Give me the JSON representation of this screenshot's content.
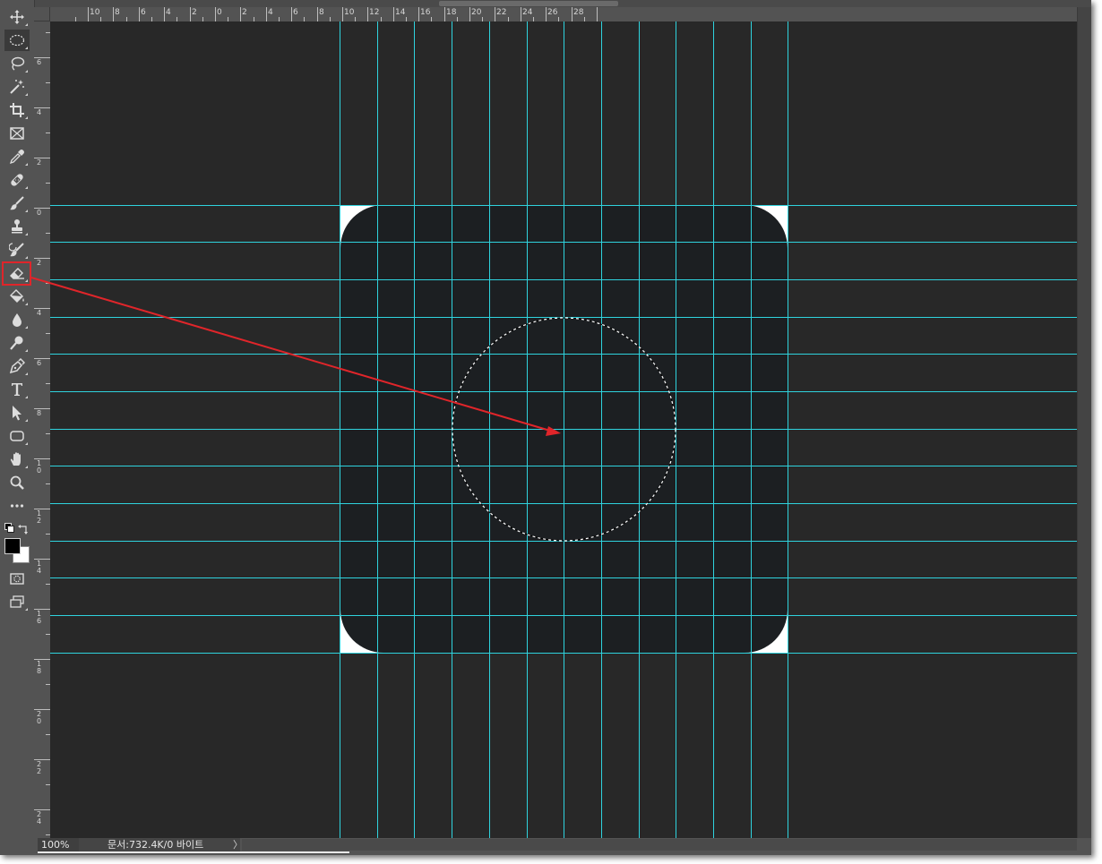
{
  "toolbar": {
    "tools": [
      {
        "name": "move-tool",
        "icon": "move-icon"
      },
      {
        "name": "elliptical-marquee-tool",
        "icon": "elliptical-marquee-icon"
      },
      {
        "name": "lasso-tool",
        "icon": "lasso-icon"
      },
      {
        "name": "magic-wand-tool",
        "icon": "magic-wand-icon"
      },
      {
        "name": "crop-tool",
        "icon": "crop-icon"
      },
      {
        "name": "frame-tool",
        "icon": "frame-icon"
      },
      {
        "name": "eyedropper-tool",
        "icon": "eyedropper-icon"
      },
      {
        "name": "healing-brush-tool",
        "icon": "bandage-icon"
      },
      {
        "name": "brush-tool",
        "icon": "brush-icon"
      },
      {
        "name": "clone-stamp-tool",
        "icon": "stamp-icon"
      },
      {
        "name": "history-brush-tool",
        "icon": "history-brush-icon"
      },
      {
        "name": "eraser-tool",
        "icon": "eraser-icon"
      },
      {
        "name": "paint-bucket-tool",
        "icon": "paint-bucket-icon"
      },
      {
        "name": "blur-tool",
        "icon": "droplet-icon"
      },
      {
        "name": "dodge-tool",
        "icon": "dodge-icon"
      },
      {
        "name": "pen-tool",
        "icon": "pen-icon"
      },
      {
        "name": "type-tool",
        "icon": "type-icon"
      },
      {
        "name": "path-selection-tool",
        "icon": "arrow-cursor-icon"
      },
      {
        "name": "rectangle-tool",
        "icon": "rounded-rectangle-icon"
      },
      {
        "name": "hand-tool",
        "icon": "hand-icon"
      },
      {
        "name": "zoom-tool",
        "icon": "magnifier-icon"
      },
      {
        "name": "edit-toolbar",
        "icon": "more-icon"
      }
    ],
    "active_tool": "elliptical-marquee-tool",
    "highlighted_tool": "eraser-tool",
    "foreground_color": "#000000",
    "background_color": "#ffffff"
  },
  "rulers": {
    "horizontal": [
      "10",
      "8",
      "6",
      "4",
      "2",
      "0",
      "2",
      "4",
      "6",
      "8",
      "10",
      "12",
      "14",
      "16",
      "18",
      "20",
      "22",
      "24",
      "26",
      "28"
    ],
    "vertical": [
      "6",
      "4",
      "2",
      "0",
      "2",
      "4",
      "6",
      "8",
      "10",
      "12",
      "14",
      "16",
      "18",
      "20",
      "22",
      "24"
    ]
  },
  "canvas": {
    "pasteboard_color": "#282828",
    "document_color": "#1c1f22",
    "corner_color": "#ffffff",
    "guide_color": "#2fd3de",
    "arrow_color": "#e0252a"
  },
  "status": {
    "zoom": "100%",
    "doc_info": "문서:732.4K/0 바이트",
    "chevron": "〉"
  }
}
